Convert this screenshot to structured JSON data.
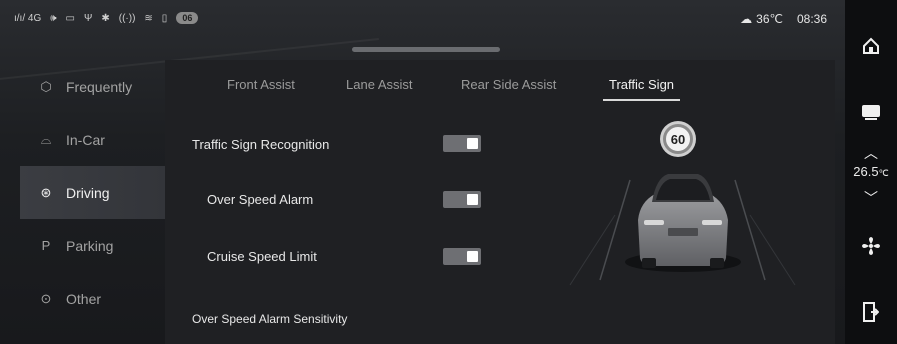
{
  "status_bar": {
    "signal": "ı/ı/ 4G",
    "badge": "06",
    "weather_icon": "weather-cloud-sun-icon",
    "temperature": "36℃",
    "time": "08:36"
  },
  "nav": {
    "items": [
      {
        "label": "Frequently",
        "icon": "cube-icon"
      },
      {
        "label": "In-Car",
        "icon": "car-outline-icon"
      },
      {
        "label": "Driving",
        "icon": "steering-wheel-icon",
        "active": true
      },
      {
        "label": "Parking",
        "icon": "parking-icon"
      },
      {
        "label": "Other",
        "icon": "more-circle-icon"
      }
    ]
  },
  "tabs": [
    {
      "label": "Front Assist"
    },
    {
      "label": "Lane Assist"
    },
    {
      "label": "Rear Side Assist"
    },
    {
      "label": "Traffic Sign",
      "active": true
    }
  ],
  "settings": {
    "traffic_sign_recognition": {
      "label": "Traffic Sign Recognition",
      "enabled": true
    },
    "over_speed_alarm": {
      "label": "Over Speed Alarm",
      "enabled": true
    },
    "cruise_speed_limit": {
      "label": "Cruise Speed Limit",
      "enabled": true
    },
    "sensitivity": {
      "label": "Over Speed Alarm Sensitivity"
    }
  },
  "speed_sign": "60",
  "dock": {
    "cabin_temperature": "26.5",
    "temperature_unit": "℃"
  },
  "colors": {
    "toggle_on": "#6e6f73",
    "active_nav": "#3b3d42",
    "panel": "#1f2023"
  }
}
